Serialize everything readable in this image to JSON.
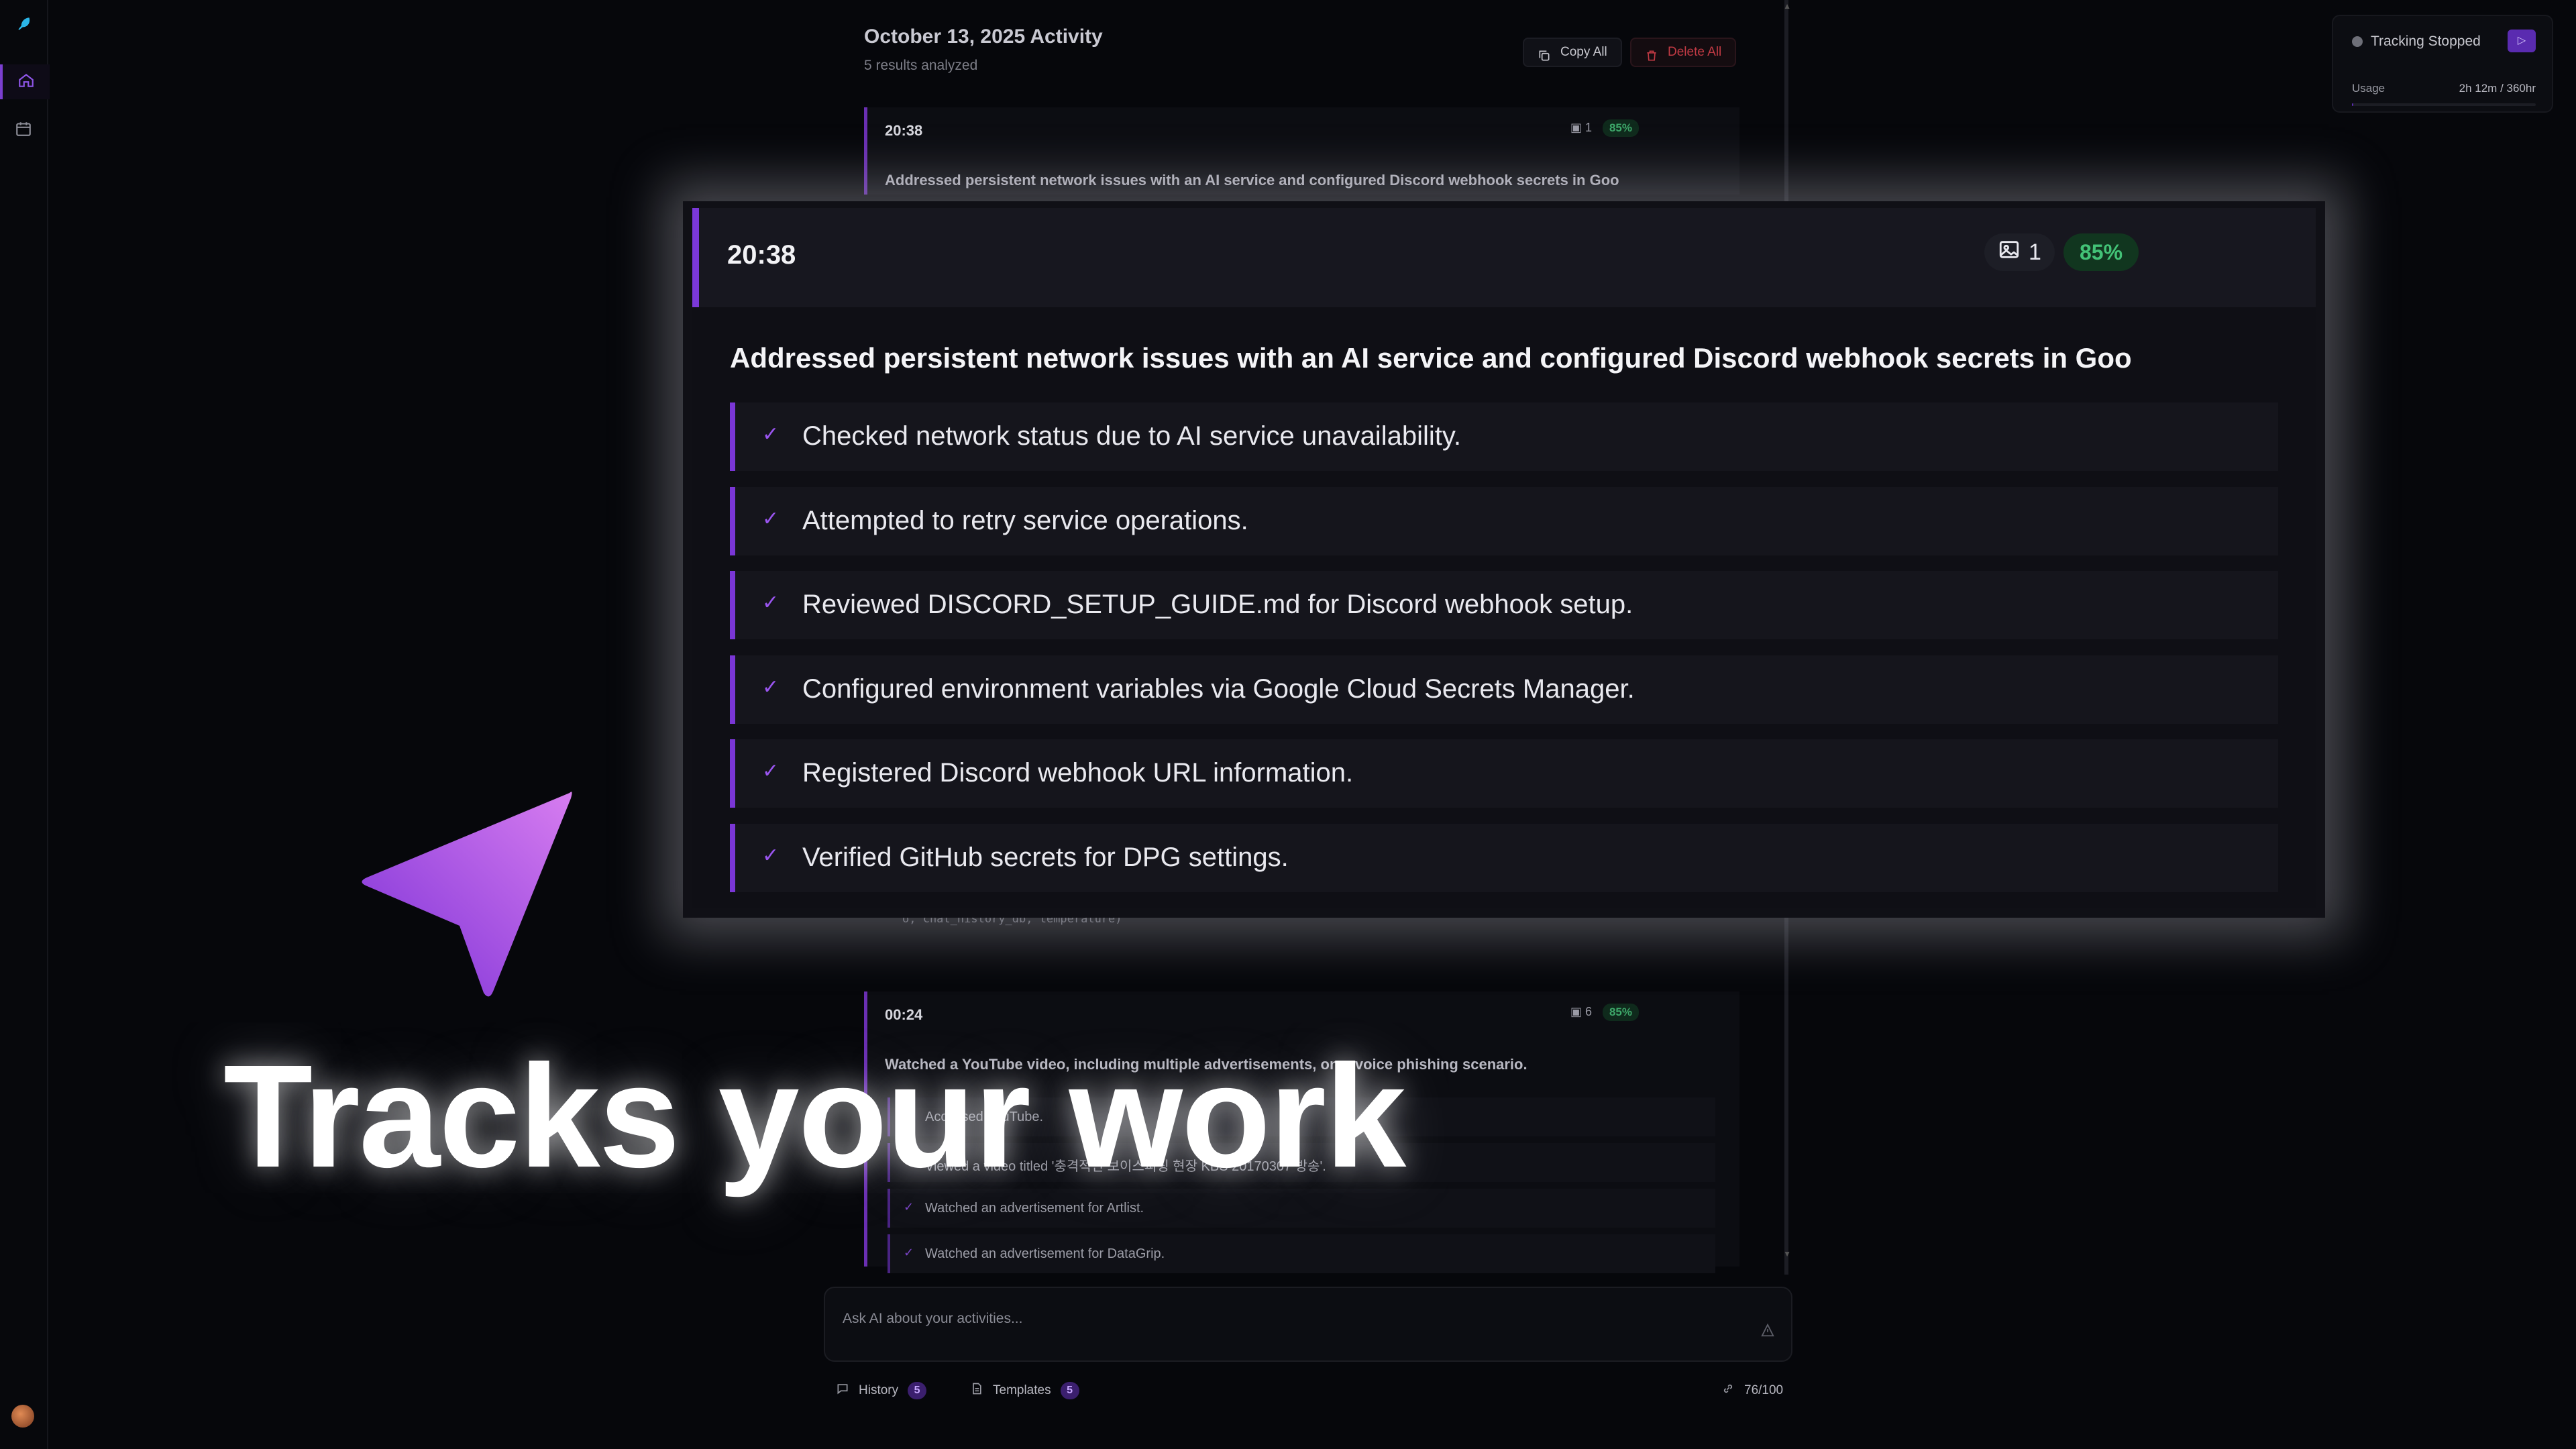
{
  "sidebar": {
    "logo_icon": "feather-logo-icon",
    "items": [
      {
        "icon": "home-icon",
        "active": true
      },
      {
        "icon": "calendar-icon",
        "active": false
      }
    ],
    "avatar_icon": "user-avatar"
  },
  "feed": {
    "title": "October 13, 2025 Activity",
    "subtitle": "5 results analyzed",
    "copy_label": "Copy All",
    "delete_label": "Delete All",
    "entries": [
      {
        "time": "20:38",
        "images": "1",
        "confidence": "85%",
        "summary": "Addressed persistent network issues with an AI service and configured Discord webhook secrets in Goo"
      },
      {
        "time": "00:24",
        "images": "6",
        "confidence": "85%",
        "summary": "Watched a YouTube video, including multiple advertisements, on a voice phishing scenario.",
        "items": [
          "Accessed YouTube.",
          "Viewed a video titled '충격적인 보이스피싱 현장 KBS 20170307 방송'.",
          "Watched an advertisement for Artlist.",
          "Watched an advertisement for DataGrip."
        ]
      }
    ],
    "faded_code": "o, chat_history_db, temperature)"
  },
  "chat": {
    "placeholder": "Ask AI about your activities...",
    "history_label": "History",
    "history_count": "5",
    "templates_label": "Templates",
    "templates_count": "5",
    "usage": "76/100"
  },
  "tracker": {
    "status": "Tracking Stopped",
    "usage_label": "Usage",
    "usage_value": "2h 12m / 360hr",
    "usage_fraction": 0.006
  },
  "zoom_card": {
    "time": "20:38",
    "images": "1",
    "confidence": "85%",
    "summary": "Addressed persistent network issues with an AI service and configured Discord webhook secrets in Goo",
    "items": [
      "Checked network status due to AI service unavailability.",
      "Attempted to retry service operations.",
      "Reviewed DISCORD_SETUP_GUIDE.md for Discord webhook setup.",
      "Configured environment variables via Google Cloud Secrets Manager.",
      "Registered Discord webhook URL information.",
      "Verified GitHub secrets for DPG settings."
    ]
  },
  "tagline": "Tracks your work",
  "colors": {
    "accent": "#7b38d8",
    "confidence_green": "#43c277",
    "delete_red": "#c23a44",
    "background": "#06070b"
  }
}
